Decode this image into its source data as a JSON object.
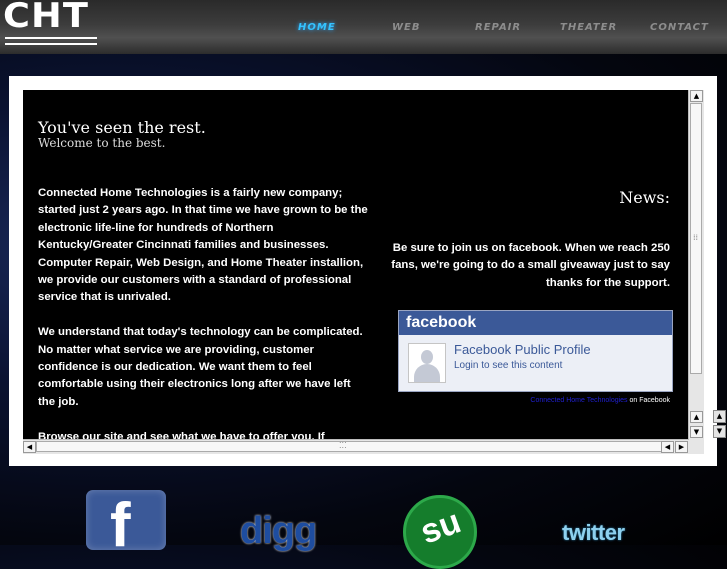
{
  "header": {
    "logo_text": "CHT",
    "nav": [
      {
        "label": "HOME",
        "active": true
      },
      {
        "label": "WEB",
        "active": false
      },
      {
        "label": "REPAIR",
        "active": false
      },
      {
        "label": "THEATER",
        "active": false
      },
      {
        "label": "CONTACT",
        "active": false
      }
    ]
  },
  "main": {
    "headline": "You've seen the rest.",
    "subheadline": "Welcome to the best.",
    "paragraphs": [
      "Connected Home Technologies is a fairly new company; started just 2 years ago. In that time we have grown to be the electronic life-line for hundreds of Northern Kentucky/Greater Cincinnati families and businesses. Computer Repair, Web Design, and Home Theater installion, we provide our customers with a standard of professional service that is unrivaled.",
      "We understand that today's technology can be complicated. No matter what service we are providing, customer confidence is our dedication. We want them to feel comfortable using their electronics long after we have left the job.",
      "Browse our site and see what we have to offer you. If"
    ],
    "news": {
      "title": "News:",
      "body": "Be sure to join us on facebook. When we reach 250 fans, we're going to do a small giveaway just to say thanks for the support."
    },
    "facebook_widget": {
      "brand": "facebook",
      "profile_link": "Facebook Public Profile",
      "login_text": "Login to see this content",
      "footer_link": "Connected Home Technologies",
      "footer_suffix": "on Facebook"
    }
  },
  "social": {
    "facebook": "f",
    "digg": "digg",
    "stumbleupon": "su",
    "twitter": "twitter"
  },
  "colors": {
    "nav_active": "#34c3ff",
    "facebook_blue": "#3b5998"
  }
}
